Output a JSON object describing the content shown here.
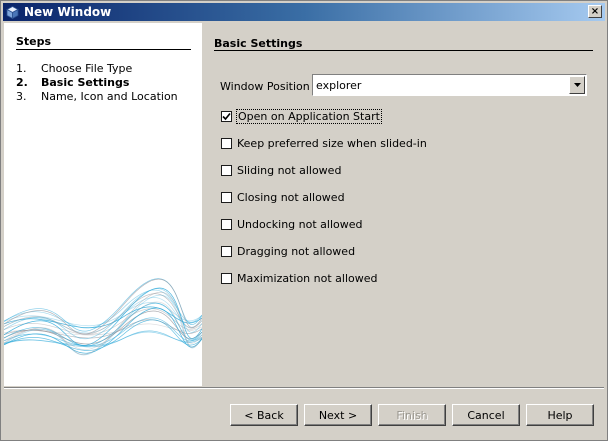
{
  "window": {
    "title": "New Window",
    "close_label": "×"
  },
  "steps": {
    "title": "Steps",
    "items": [
      {
        "num": "1.",
        "label": "Choose File Type",
        "active": false
      },
      {
        "num": "2.",
        "label": "Basic Settings",
        "active": true
      },
      {
        "num": "3.",
        "label": "Name, Icon and Location",
        "active": false
      }
    ]
  },
  "main": {
    "title": "Basic Settings",
    "window_position_label": "Window Position :",
    "window_position_value": "explorer",
    "checkboxes": [
      {
        "label": "Open on Application Start",
        "checked": true
      },
      {
        "label": "Keep preferred size when slided-in",
        "checked": false
      },
      {
        "label": "Sliding not allowed",
        "checked": false
      },
      {
        "label": "Closing not allowed",
        "checked": false
      },
      {
        "label": "Undocking not allowed",
        "checked": false
      },
      {
        "label": "Dragging not allowed",
        "checked": false
      },
      {
        "label": "Maximization not allowed",
        "checked": false
      }
    ]
  },
  "buttons": {
    "back": "< Back",
    "next": "Next >",
    "finish": "Finish",
    "cancel": "Cancel",
    "help": "Help"
  },
  "colors": {
    "titlebar_start": "#0a246a",
    "titlebar_end": "#a6caf0",
    "dialog_bg": "#d4d0c8",
    "wave_blue": "#2aa7d8",
    "wave_grey": "#9a9aa0"
  }
}
